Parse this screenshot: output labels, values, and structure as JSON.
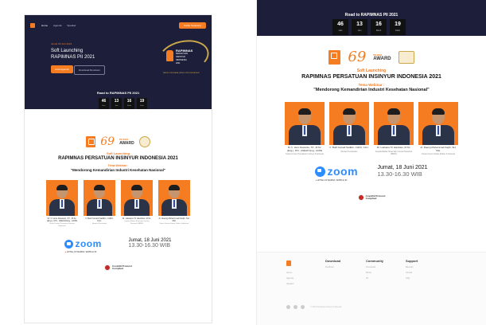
{
  "left": {
    "nav": {
      "links": [
        "Home",
        "Agenda",
        "Speaker"
      ],
      "register": "Daftar Sekarang"
    },
    "hero": {
      "kicker": "Jumat 18 Juni 2021",
      "title_line1": "Soft Launching",
      "title_line2": "RAPIMNAS PII 2021",
      "btn_primary": "Lihat Agenda",
      "btn_secondary": "Download Rundown",
      "graphic": {
        "l1": "RAPIMNAS",
        "l2": "PERSATUAN",
        "l3": "INSINYUR",
        "l4": "INDONESIA",
        "l5": "2021",
        "l6": "BANGKIT BERSAMA, MENUJU INDONESIA MAJU"
      }
    },
    "countdown": {
      "title": "Road to RAPIMNAS PII 2021",
      "items": [
        {
          "num": "46",
          "label": "Hari"
        },
        {
          "num": "13",
          "label": "Jam"
        },
        {
          "num": "16",
          "label": "Menit"
        },
        {
          "num": "19",
          "label": "Detik"
        }
      ]
    }
  },
  "right": {
    "countdown": {
      "title": "Road to RAPIMNAS PII 2021",
      "items": [
        {
          "num": "46",
          "label": "Hari"
        },
        {
          "num": "13",
          "label": "Jam"
        },
        {
          "num": "16",
          "label": "Menit"
        },
        {
          "num": "19",
          "label": "Detik"
        }
      ]
    }
  },
  "logos": {
    "award_num": "69",
    "award_l1": "PII 2021",
    "award_l2": "AWARD",
    "pii": "PII"
  },
  "event": {
    "soft": "Soft Launching",
    "main": "RAPIMNAS PERSATUAN INSINYUR INDONESIA 2021",
    "tema": "Tema Webinar :",
    "quote": "\"Mendorong Kemandirian Industri Kesehatan Nasional\""
  },
  "speakers": [
    {
      "name": "Dr. Ir. Heru Dewanto, ST., M.Sc.(Eng.), IPU., ASEAN Eng., ACPE",
      "role": "Ketua Umum Persatuan Insinyur Indonesia"
    },
    {
      "name": "Ir. Budi Gunadi Sadikin, CHFC, CLU.",
      "role": "Menteri Kesehatan"
    },
    {
      "name": "Dr. Laksana Tri Handoko, M.Sc.",
      "role": "Kepala Badan Riset dan Inovasi Nasional (BRIN)"
    },
    {
      "name": "dr. Daeng Mohammad Faqih, SH, MH.",
      "role": "Ketua Umum Ikatan Dokter Indonesia"
    }
  ],
  "venue": {
    "zoom": "zoom",
    "hotel": "HOTEL 23 WARDA, WWW.IA.ID",
    "date": "Jumat, 18 Juni 2021",
    "time": "13.30-16.30 WIB"
  },
  "covid": {
    "l1": "Covid19 Protocol",
    "l2": "Complied"
  },
  "footer": {
    "cols": [
      {
        "head": "Download",
        "items": [
          "Rundown"
        ]
      },
      {
        "head": "Community",
        "items": [
          "Komunitas",
          "Berita",
          "PII"
        ]
      },
      {
        "head": "Support",
        "items": [
          "Bantuan",
          "Kontak",
          "FAQ"
        ]
      }
    ],
    "brand_items": [
      "Home",
      "Agenda",
      "Speaker"
    ],
    "copy": "© 2021 Persatuan Insinyur Indonesia"
  },
  "colors": {
    "accent": "#f57c20",
    "navy": "#1d1f3a",
    "zoom": "#2d8cff"
  }
}
